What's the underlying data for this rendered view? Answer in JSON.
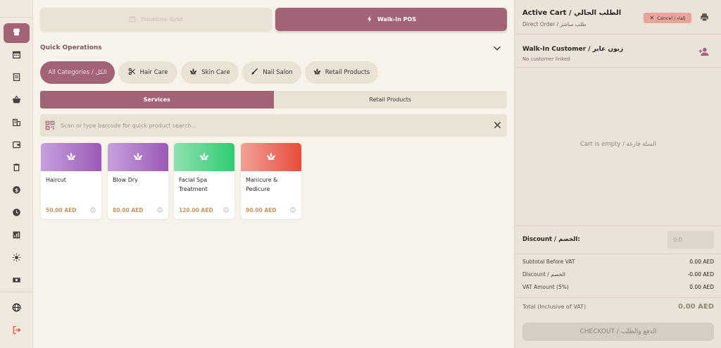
{
  "sidebar": {
    "items": [
      {
        "icon": "store-icon",
        "active": true
      },
      {
        "icon": "calendar-icon",
        "active": false
      },
      {
        "icon": "book-icon",
        "active": false
      },
      {
        "icon": "basket-icon",
        "active": false
      },
      {
        "icon": "building-icon",
        "active": false
      },
      {
        "icon": "wallet-icon",
        "active": false
      },
      {
        "icon": "trash-icon",
        "active": false
      },
      {
        "icon": "dollar-icon",
        "active": false
      },
      {
        "icon": "clock-icon",
        "active": false
      },
      {
        "icon": "chart-icon",
        "active": false
      },
      {
        "icon": "sun-icon",
        "active": false
      },
      {
        "icon": "cash-icon",
        "active": false
      }
    ],
    "bottom": [
      {
        "icon": "globe-icon"
      },
      {
        "icon": "logout-icon"
      }
    ]
  },
  "modes": {
    "timeline_label": "Timeline Grid",
    "walkin_label": "Walk-In POS"
  },
  "quick_ops": {
    "title": "Quick Operations",
    "chips": [
      {
        "label": "All Categories / الكل",
        "icon": "",
        "active": true
      },
      {
        "label": "Hair Care",
        "icon": "scissors-icon",
        "active": false
      },
      {
        "label": "Skin Care",
        "icon": "lotus-icon",
        "active": false
      },
      {
        "label": "Nail Salon",
        "icon": "brush-icon",
        "active": false
      },
      {
        "label": "Retail Products",
        "icon": "lotus-icon",
        "active": false
      }
    ]
  },
  "tabs": {
    "services": "Services",
    "retail": "Retail Products"
  },
  "search": {
    "placeholder": "Scan or type barcode for quick product search...",
    "value": ""
  },
  "products": [
    {
      "name": "Haircut",
      "price": "50.00 AED",
      "color_from": "#c6a0dc",
      "color_to": "#9b59b6"
    },
    {
      "name": "Blow Dry",
      "price": "80.00 AED",
      "color_from": "#c6a0dc",
      "color_to": "#9b59b6"
    },
    {
      "name": "Facial Spa Treatment",
      "price": "120.00 AED",
      "color_from": "#8fe0b0",
      "color_to": "#2ecc71"
    },
    {
      "name": "Manicure & Pedicure",
      "price": "90.00 AED",
      "color_from": "#f0a097",
      "color_to": "#e74c3c"
    }
  ],
  "cart": {
    "title": "Active Cart / الطلب الحالي",
    "subtitle": "Direct Order / طلب مباشر",
    "cancel_label": "Cancel / إلغاء",
    "customer_title": "Walk-In Customer / زبون عابر",
    "customer_sub": "No customer linked",
    "empty_text": "Cart is empty / السلة فارغة",
    "discount_label": "Discount / الخصم:",
    "discount_placeholder": "0.0",
    "discount_value": "",
    "summary": [
      {
        "label": "Subtotal Before VAT",
        "value": "0.00 AED"
      },
      {
        "label": "Discount / الخصم",
        "value": "-0.00 AED"
      },
      {
        "label": "VAT Amount (5%)",
        "value": "0.00 AED"
      }
    ],
    "total_label": "Total (Inclusive of VAT)",
    "total_value": "0.00 AED",
    "checkout_label": "CHECKOUT / الدفع والطلب"
  },
  "colors": {
    "accent": "#a26377",
    "background": "#f7f2ea",
    "panel": "#ebe3d7",
    "price": "#c7925a"
  }
}
